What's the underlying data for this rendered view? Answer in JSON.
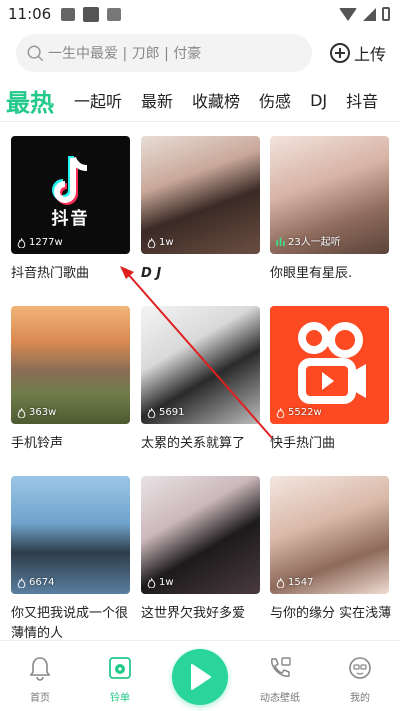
{
  "status_bar": {
    "time": "11:06"
  },
  "search": {
    "placeholder": "一生中最爱 | 刀郎 | 付豪",
    "upload_label": "上传"
  },
  "tabs": [
    {
      "label": "最热",
      "active": true
    },
    {
      "label": "一起听"
    },
    {
      "label": "最新"
    },
    {
      "label": "收藏榜"
    },
    {
      "label": "伤感"
    },
    {
      "label": "DJ"
    },
    {
      "label": "抖音"
    }
  ],
  "cards": [
    {
      "title": "抖音热门歌曲",
      "count": "1277w",
      "thumb": "douyin-logo"
    },
    {
      "title": "D J",
      "count": "1w",
      "thumb": "girl-photo"
    },
    {
      "title": "你眼里有星辰.",
      "count": "23人一起听",
      "thumb": "girl-photo"
    },
    {
      "title": "手机铃声",
      "count": "363w",
      "thumb": "horse-rider-sunset"
    },
    {
      "title": "太累的关系就算了",
      "count": "5691",
      "thumb": "girl-photo"
    },
    {
      "title": "快手热门曲",
      "count": "5522w",
      "thumb": "kuaishou-logo"
    },
    {
      "title": "你又把我说成一个很薄情的人",
      "count": "6674",
      "thumb": "girl-by-sea"
    },
    {
      "title": "这世界欠我好多爱",
      "count": "1w",
      "thumb": "girl-photo"
    },
    {
      "title": "与你的缘分 实在浅薄",
      "count": "1547",
      "thumb": "girl-photo"
    }
  ],
  "douyin_logo_text": "抖音",
  "bottom_nav": [
    {
      "label": "首页",
      "icon": "bell-icon"
    },
    {
      "label": "铃单",
      "icon": "ringtone-list-icon",
      "active": true
    },
    {
      "label": "",
      "icon": "play-icon"
    },
    {
      "label": "动态壁纸",
      "icon": "phone-wallpaper-icon"
    },
    {
      "label": "我的",
      "icon": "profile-icon"
    }
  ],
  "colors": {
    "accent": "#23c98a",
    "play_button": "#29d59b",
    "arrow": "#e02020"
  }
}
